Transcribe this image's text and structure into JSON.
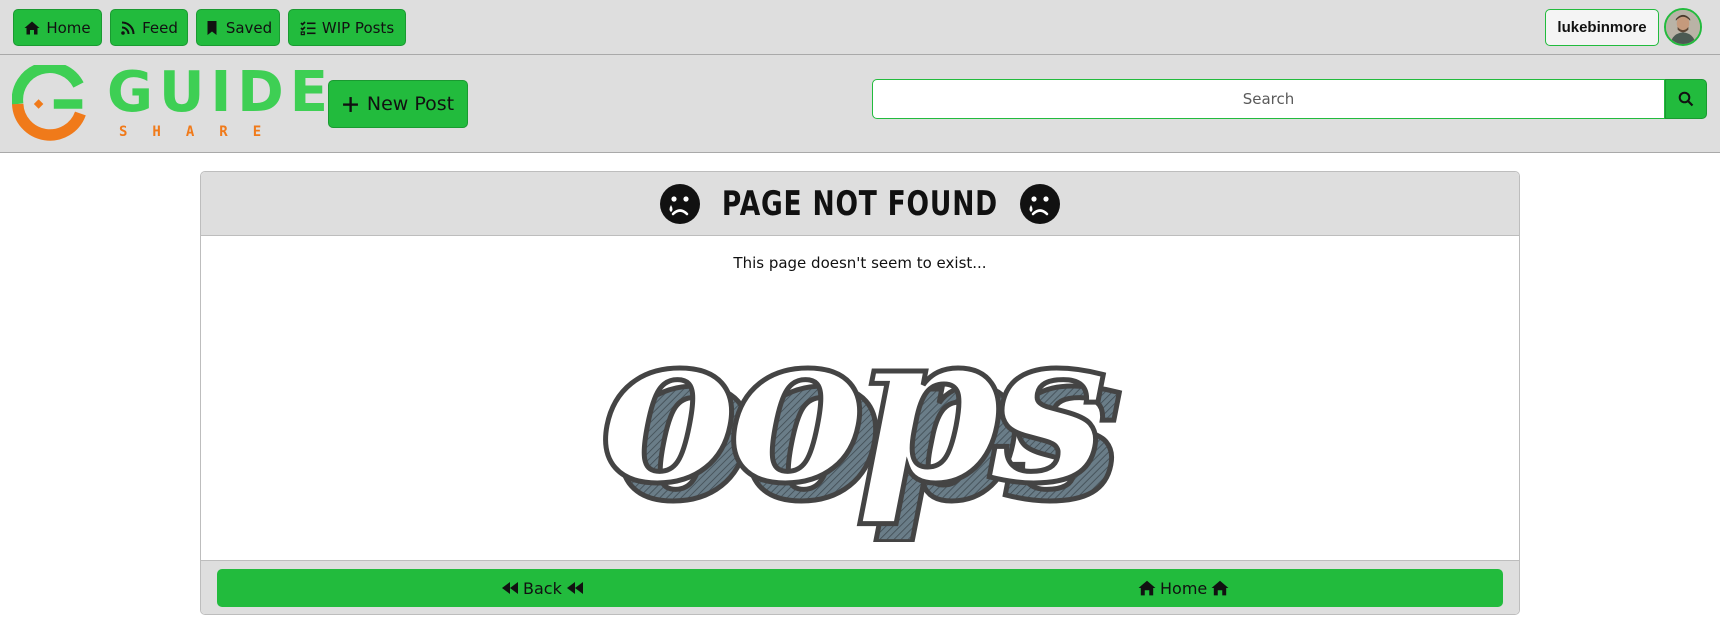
{
  "topnav": {
    "items": [
      {
        "label": "Home",
        "icon": "home-icon"
      },
      {
        "label": "Feed",
        "icon": "rss-feed-icon"
      },
      {
        "label": "Saved",
        "icon": "bookmark-icon"
      },
      {
        "label": "WIP Posts",
        "icon": "list-check-icon"
      }
    ],
    "username": "lukebinmore"
  },
  "header": {
    "logo_word": "GUIDE",
    "logo_sub": "SHARE",
    "new_post_label": "New Post",
    "search_placeholder": "Search"
  },
  "error_card": {
    "title": "PAGE NOT FOUND",
    "message": "This page doesn't seem to exist...",
    "art_text": "oops",
    "back_label": "Back",
    "home_label": "Home"
  },
  "colors": {
    "accent": "#22bb3d",
    "logo_green": "#3ecf54",
    "logo_orange": "#f07a1a",
    "bar_gray": "#dedede"
  }
}
